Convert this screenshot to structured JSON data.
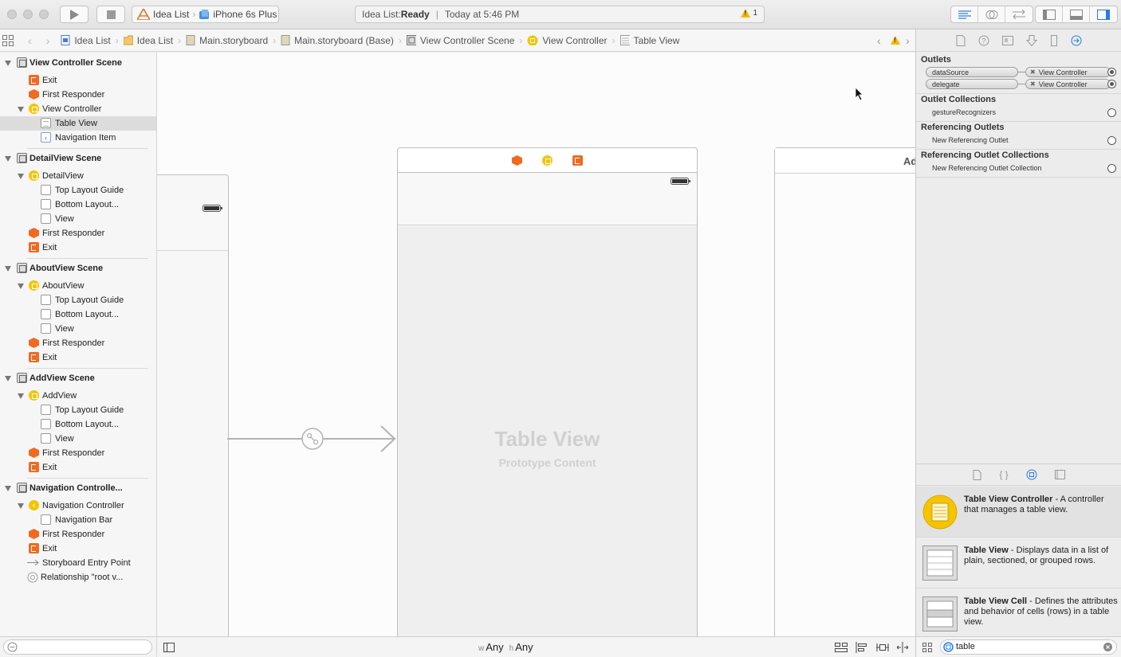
{
  "toolbar": {
    "scheme_target": "Idea List",
    "scheme_device": "iPhone 6s Plus",
    "activity_project": "Idea List: ",
    "activity_status": "Ready",
    "activity_sep": "|",
    "activity_time": "Today at 5:46 PM",
    "warning_count": "1"
  },
  "jumpbar": {
    "crumbs": [
      "Idea List",
      "Idea List",
      "Main.storyboard",
      "Main.storyboard (Base)",
      "View Controller Scene",
      "View Controller",
      "Table View"
    ]
  },
  "outline": {
    "rows": [
      {
        "label": "View Controller Scene"
      },
      {
        "label": "Exit"
      },
      {
        "label": "First Responder"
      },
      {
        "label": "View Controller"
      },
      {
        "label": "Table View"
      },
      {
        "label": "Navigation Item"
      },
      {
        "label": "DetailView Scene"
      },
      {
        "label": "DetailView"
      },
      {
        "label": "Top Layout Guide"
      },
      {
        "label": "Bottom Layout..."
      },
      {
        "label": "View"
      },
      {
        "label": "First Responder"
      },
      {
        "label": "Exit"
      },
      {
        "label": "AboutView Scene"
      },
      {
        "label": "AboutView"
      },
      {
        "label": "Top Layout Guide"
      },
      {
        "label": "Bottom Layout..."
      },
      {
        "label": "View"
      },
      {
        "label": "First Responder"
      },
      {
        "label": "Exit"
      },
      {
        "label": "AddView Scene"
      },
      {
        "label": "AddView"
      },
      {
        "label": "Top Layout Guide"
      },
      {
        "label": "Bottom Layout..."
      },
      {
        "label": "View"
      },
      {
        "label": "First Responder"
      },
      {
        "label": "Exit"
      },
      {
        "label": "Navigation Controlle..."
      },
      {
        "label": "Navigation Controller"
      },
      {
        "label": "Navigation Bar"
      },
      {
        "label": "First Responder"
      },
      {
        "label": "Exit"
      },
      {
        "label": "Storyboard Entry Point"
      },
      {
        "label": "Relationship \"root v..."
      }
    ]
  },
  "canvas": {
    "table_view_title": "Table View",
    "table_view_subtitle": "Prototype Content",
    "partial_scene_label": "Ad",
    "size_class_w_prefix": "w",
    "size_class_w": "Any",
    "size_class_h_prefix": "h",
    "size_class_h": "Any"
  },
  "inspector": {
    "outlets_title": "Outlets",
    "outlets": [
      {
        "name": "dataSource",
        "target": "View Controller"
      },
      {
        "name": "delegate",
        "target": "View Controller"
      }
    ],
    "outlet_collections_title": "Outlet Collections",
    "outlet_collections": [
      "gestureRecognizers"
    ],
    "referencing_outlets_title": "Referencing Outlets",
    "referencing_outlets": [
      "New Referencing Outlet"
    ],
    "referencing_collections_title": "Referencing Outlet Collections",
    "referencing_collections": [
      "New Referencing Outlet Collection"
    ]
  },
  "library": {
    "items": [
      {
        "name": "Table View Controller",
        "desc": " - A controller that manages a table view."
      },
      {
        "name": "Table View",
        "desc": " - Displays data in a list of plain, sectioned, or grouped rows."
      },
      {
        "name": "Table View Cell",
        "desc": " - Defines the attributes and behavior of cells (rows) in a table view."
      }
    ],
    "search_value": "table"
  },
  "colors": {
    "accent": "#2a7ae2",
    "warning": "#f5b800",
    "object_orange": "#f06a21",
    "controller_yellow": "#f5c400"
  }
}
